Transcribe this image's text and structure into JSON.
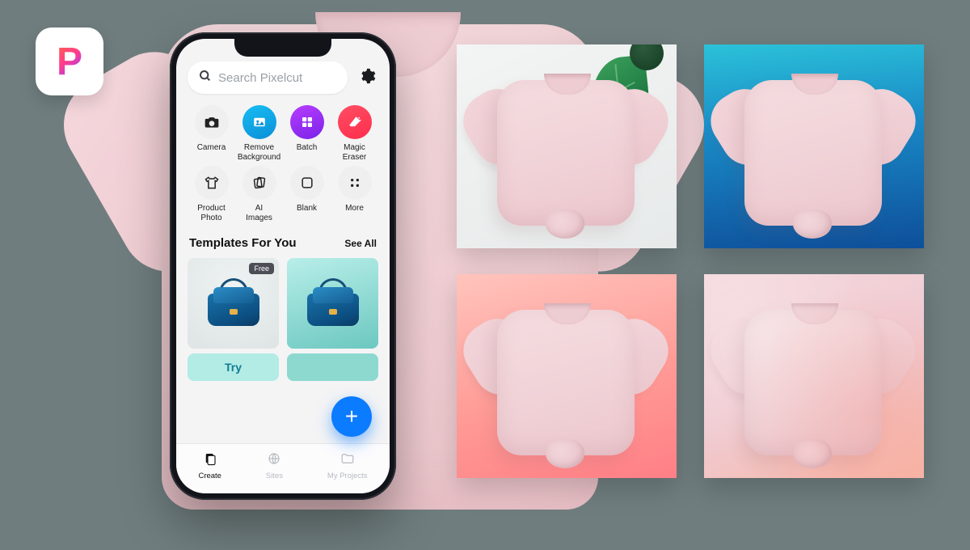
{
  "app": {
    "name": "Pixelcut"
  },
  "search": {
    "placeholder": "Search Pixelcut"
  },
  "tools": {
    "row1": [
      {
        "label": "Camera"
      },
      {
        "label": "Remove\nBackground"
      },
      {
        "label": "Batch"
      },
      {
        "label": "Magic\nEraser"
      }
    ],
    "row2": [
      {
        "label": "Product\nPhoto"
      },
      {
        "label": "AI\nImages"
      },
      {
        "label": "Blank"
      },
      {
        "label": "More"
      }
    ]
  },
  "templates": {
    "title": "Templates For You",
    "see_all": "See All",
    "badge_free": "Free",
    "try_label": "Try"
  },
  "tabs": {
    "create": "Create",
    "sites": "Sites",
    "projects": "My Projects"
  },
  "fab": {
    "glyph": "+"
  },
  "colors": {
    "primary_blue": "#0b7bff",
    "try_button": "#b3ebe5"
  }
}
